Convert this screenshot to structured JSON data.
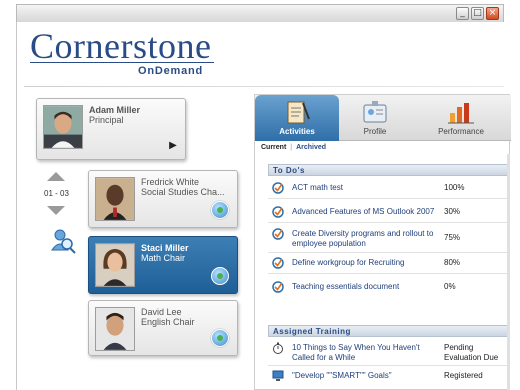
{
  "window": {
    "buttons": [
      "minimize",
      "maximize",
      "close"
    ]
  },
  "logo": {
    "main": "Cornerstone",
    "sub": "OnDemand"
  },
  "manager": {
    "name": "Adam Miller",
    "title": "Principal"
  },
  "pager": {
    "range": "01 - 03"
  },
  "reports": [
    {
      "name": "Fredrick White",
      "title": "Social Studies Cha...",
      "selected": false
    },
    {
      "name": "Staci Miller",
      "title": "Math Chair",
      "selected": true
    },
    {
      "name": "David Lee",
      "title": "English Chair",
      "selected": false
    }
  ],
  "tabs": [
    {
      "label": "Activities",
      "icon": "clipboard-icon",
      "active": true
    },
    {
      "label": "Profile",
      "icon": "id-badge-icon",
      "active": false
    },
    {
      "label": "Performance",
      "icon": "bar-chart-icon",
      "active": false
    }
  ],
  "subtabs": {
    "current": "Current",
    "separator": "|",
    "archived": "Archived"
  },
  "todos": {
    "title": "To Do's",
    "items": [
      {
        "name": "ACT math test",
        "value": "100%"
      },
      {
        "name": "Advanced Features of MS Outlook 2007",
        "value": "30%"
      },
      {
        "name": "Create Diversity programs and rollout to employee population",
        "value": "75%"
      },
      {
        "name": "Define workgroup for Recruiting",
        "value": "80%"
      },
      {
        "name": "Teaching essentials document",
        "value": "0%"
      }
    ]
  },
  "training": {
    "title": "Assigned Training",
    "items": [
      {
        "name": "10 Things to Say When You Haven't Called for a While",
        "value": "Pending Evaluation Due",
        "icon": "stopwatch-icon"
      },
      {
        "name": "\"Develop \"\"SMART\"\" Goals\"",
        "value": "Registered",
        "icon": "monitor-icon"
      }
    ]
  },
  "colors": {
    "brand": "#2a4c86",
    "selected": "#2f6ea8",
    "link": "#1f3f7a"
  }
}
